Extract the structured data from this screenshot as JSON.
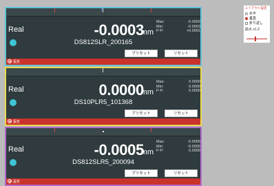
{
  "panels": [
    {
      "border_color": "#5ec3d6",
      "mode": "Real",
      "value": "-0.0003",
      "unit": "mm",
      "stats": [
        {
          "label": "Max:",
          "value": "-0.0002"
        },
        {
          "label": "Min:",
          "value": "-0.0003"
        },
        {
          "label": "P-P:",
          "value": "+0.0001"
        }
      ],
      "sensor_name": "DS812SLR_200165",
      "preset_label": "プリセット",
      "reset_label": "リセット",
      "footer_label": "設定"
    },
    {
      "border_color": "#e7d84a",
      "mode": "Real",
      "value": "0.0000",
      "unit": "mm",
      "stats": [
        {
          "label": "Max:",
          "value": "0.0000"
        },
        {
          "label": "Min:",
          "value": "0.0000"
        },
        {
          "label": "P-P:",
          "value": "0.0000"
        }
      ],
      "sensor_name": "DS10PLR5_101368",
      "preset_label": "プリセット",
      "reset_label": "リセット",
      "footer_label": "設定"
    },
    {
      "border_color": "#b069c9",
      "mode": "Real",
      "value": "-0.0005",
      "unit": "mm",
      "stats": [
        {
          "label": "Max:",
          "value": "-0.0005"
        },
        {
          "label": "Min:",
          "value": "-0.0005"
        },
        {
          "label": "P-P:",
          "value": "0.0000"
        }
      ],
      "sensor_name": "DS812SLR5_200094",
      "preset_label": "プリセット",
      "reset_label": "リセット",
      "footer_label": "設定"
    }
  ],
  "layout_settings": {
    "title": "レイアウト設定",
    "options": [
      {
        "label": "水平",
        "type": "radio",
        "selected": false
      },
      {
        "label": "垂直",
        "type": "radio",
        "selected": true
      },
      {
        "label": "折り返し",
        "type": "checkbox",
        "selected": false
      }
    ],
    "zoom_label": "拡大 x1.3",
    "zoom_value": 1.3
  },
  "colors": {
    "panel_bg": "#2f3b3f",
    "footer": "#c9332b",
    "led": "#3fc4d6"
  }
}
